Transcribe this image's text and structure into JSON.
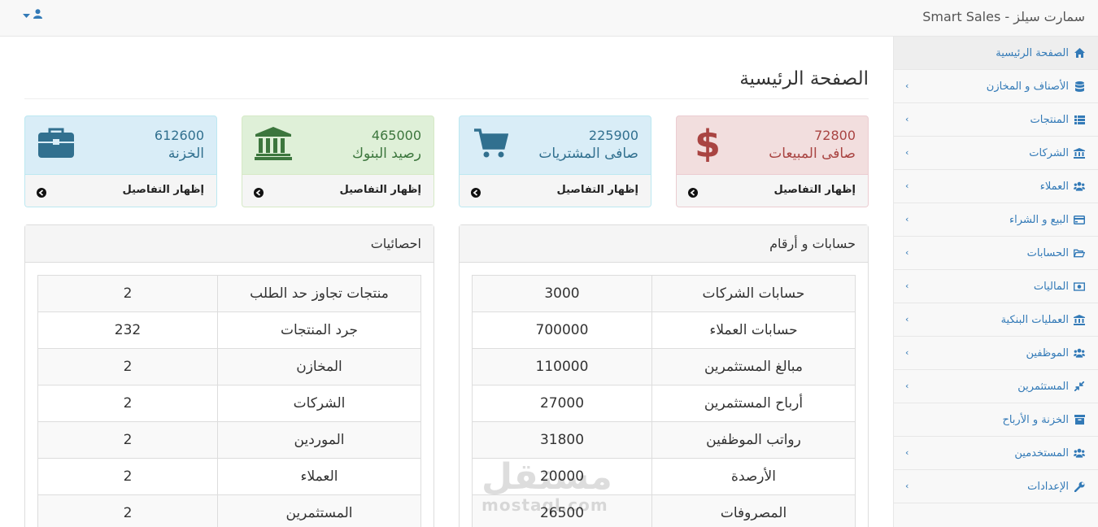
{
  "navbar": {
    "brand": "Smart Sales - سمارت سيلز",
    "user_icon": "user-icon",
    "caret_icon": "caret-down-icon"
  },
  "sidebar": {
    "items": [
      {
        "label": "الصفحة الرئيسية",
        "icon": "home-icon",
        "active": true
      },
      {
        "label": "الأصناف و المخازن",
        "icon": "database-icon"
      },
      {
        "label": "المنتجات",
        "icon": "list-icon"
      },
      {
        "label": "الشركات",
        "icon": "bank-icon"
      },
      {
        "label": "العملاء",
        "icon": "users-icon"
      },
      {
        "label": "البيع و الشراء",
        "icon": "credit-card-icon"
      },
      {
        "label": "الحسابات",
        "icon": "folder-open-icon"
      },
      {
        "label": "الماليات",
        "icon": "money-icon"
      },
      {
        "label": "العمليات البنكية",
        "icon": "bank-icon"
      },
      {
        "label": "الموظفين",
        "icon": "users-icon"
      },
      {
        "label": "المستثمرين",
        "icon": "compress-icon"
      },
      {
        "label": "الخزنة و الأرباح",
        "icon": "archive-icon"
      },
      {
        "label": "المستخدمين",
        "icon": "users-icon"
      },
      {
        "label": "الإعدادات",
        "icon": "wrench-icon"
      }
    ]
  },
  "page": {
    "title": "الصفحة الرئيسية"
  },
  "stats": [
    {
      "value": "72800",
      "label": "صافى المبيعات",
      "details": "إظهار التفاصيل",
      "icon": "dollar-icon",
      "color": "#a94442"
    },
    {
      "value": "225900",
      "label": "صافى المشتريات",
      "details": "إظهار التفاصيل",
      "icon": "shopping-cart-icon",
      "color": "#31708f"
    },
    {
      "value": "465000",
      "label": "رصيد البنوك",
      "details": "إظهار التفاصيل",
      "icon": "bank-icon",
      "color": "#3c763d"
    },
    {
      "value": "612600",
      "label": "الخزنة",
      "details": "إظهار التفاصيل",
      "icon": "briefcase-icon",
      "color": "#31708f"
    }
  ],
  "accounts": {
    "title": "حسابات و أرقام",
    "rows": [
      {
        "label": "حسابات الشركات",
        "value": "3000"
      },
      {
        "label": "حسابات العملاء",
        "value": "700000"
      },
      {
        "label": "مبالغ المستثمرين",
        "value": "110000"
      },
      {
        "label": "أرباح المستثمرين",
        "value": "27000"
      },
      {
        "label": "رواتب الموظفين",
        "value": "31800"
      },
      {
        "label": "الأرصدة",
        "value": "20000"
      },
      {
        "label": "المصروفات",
        "value": "26500"
      }
    ]
  },
  "statistics": {
    "title": "احصائيات",
    "rows": [
      {
        "label": "منتجات تجاوز حد الطلب",
        "value": "2"
      },
      {
        "label": "جرد المنتجات",
        "value": "232"
      },
      {
        "label": "المخازن",
        "value": "2"
      },
      {
        "label": "الشركات",
        "value": "2"
      },
      {
        "label": "الموردين",
        "value": "2"
      },
      {
        "label": "العملاء",
        "value": "2"
      },
      {
        "label": "المستثمرين",
        "value": "2"
      }
    ]
  },
  "watermark": {
    "arabic": "مستقل",
    "latin": "mostaql.com"
  }
}
